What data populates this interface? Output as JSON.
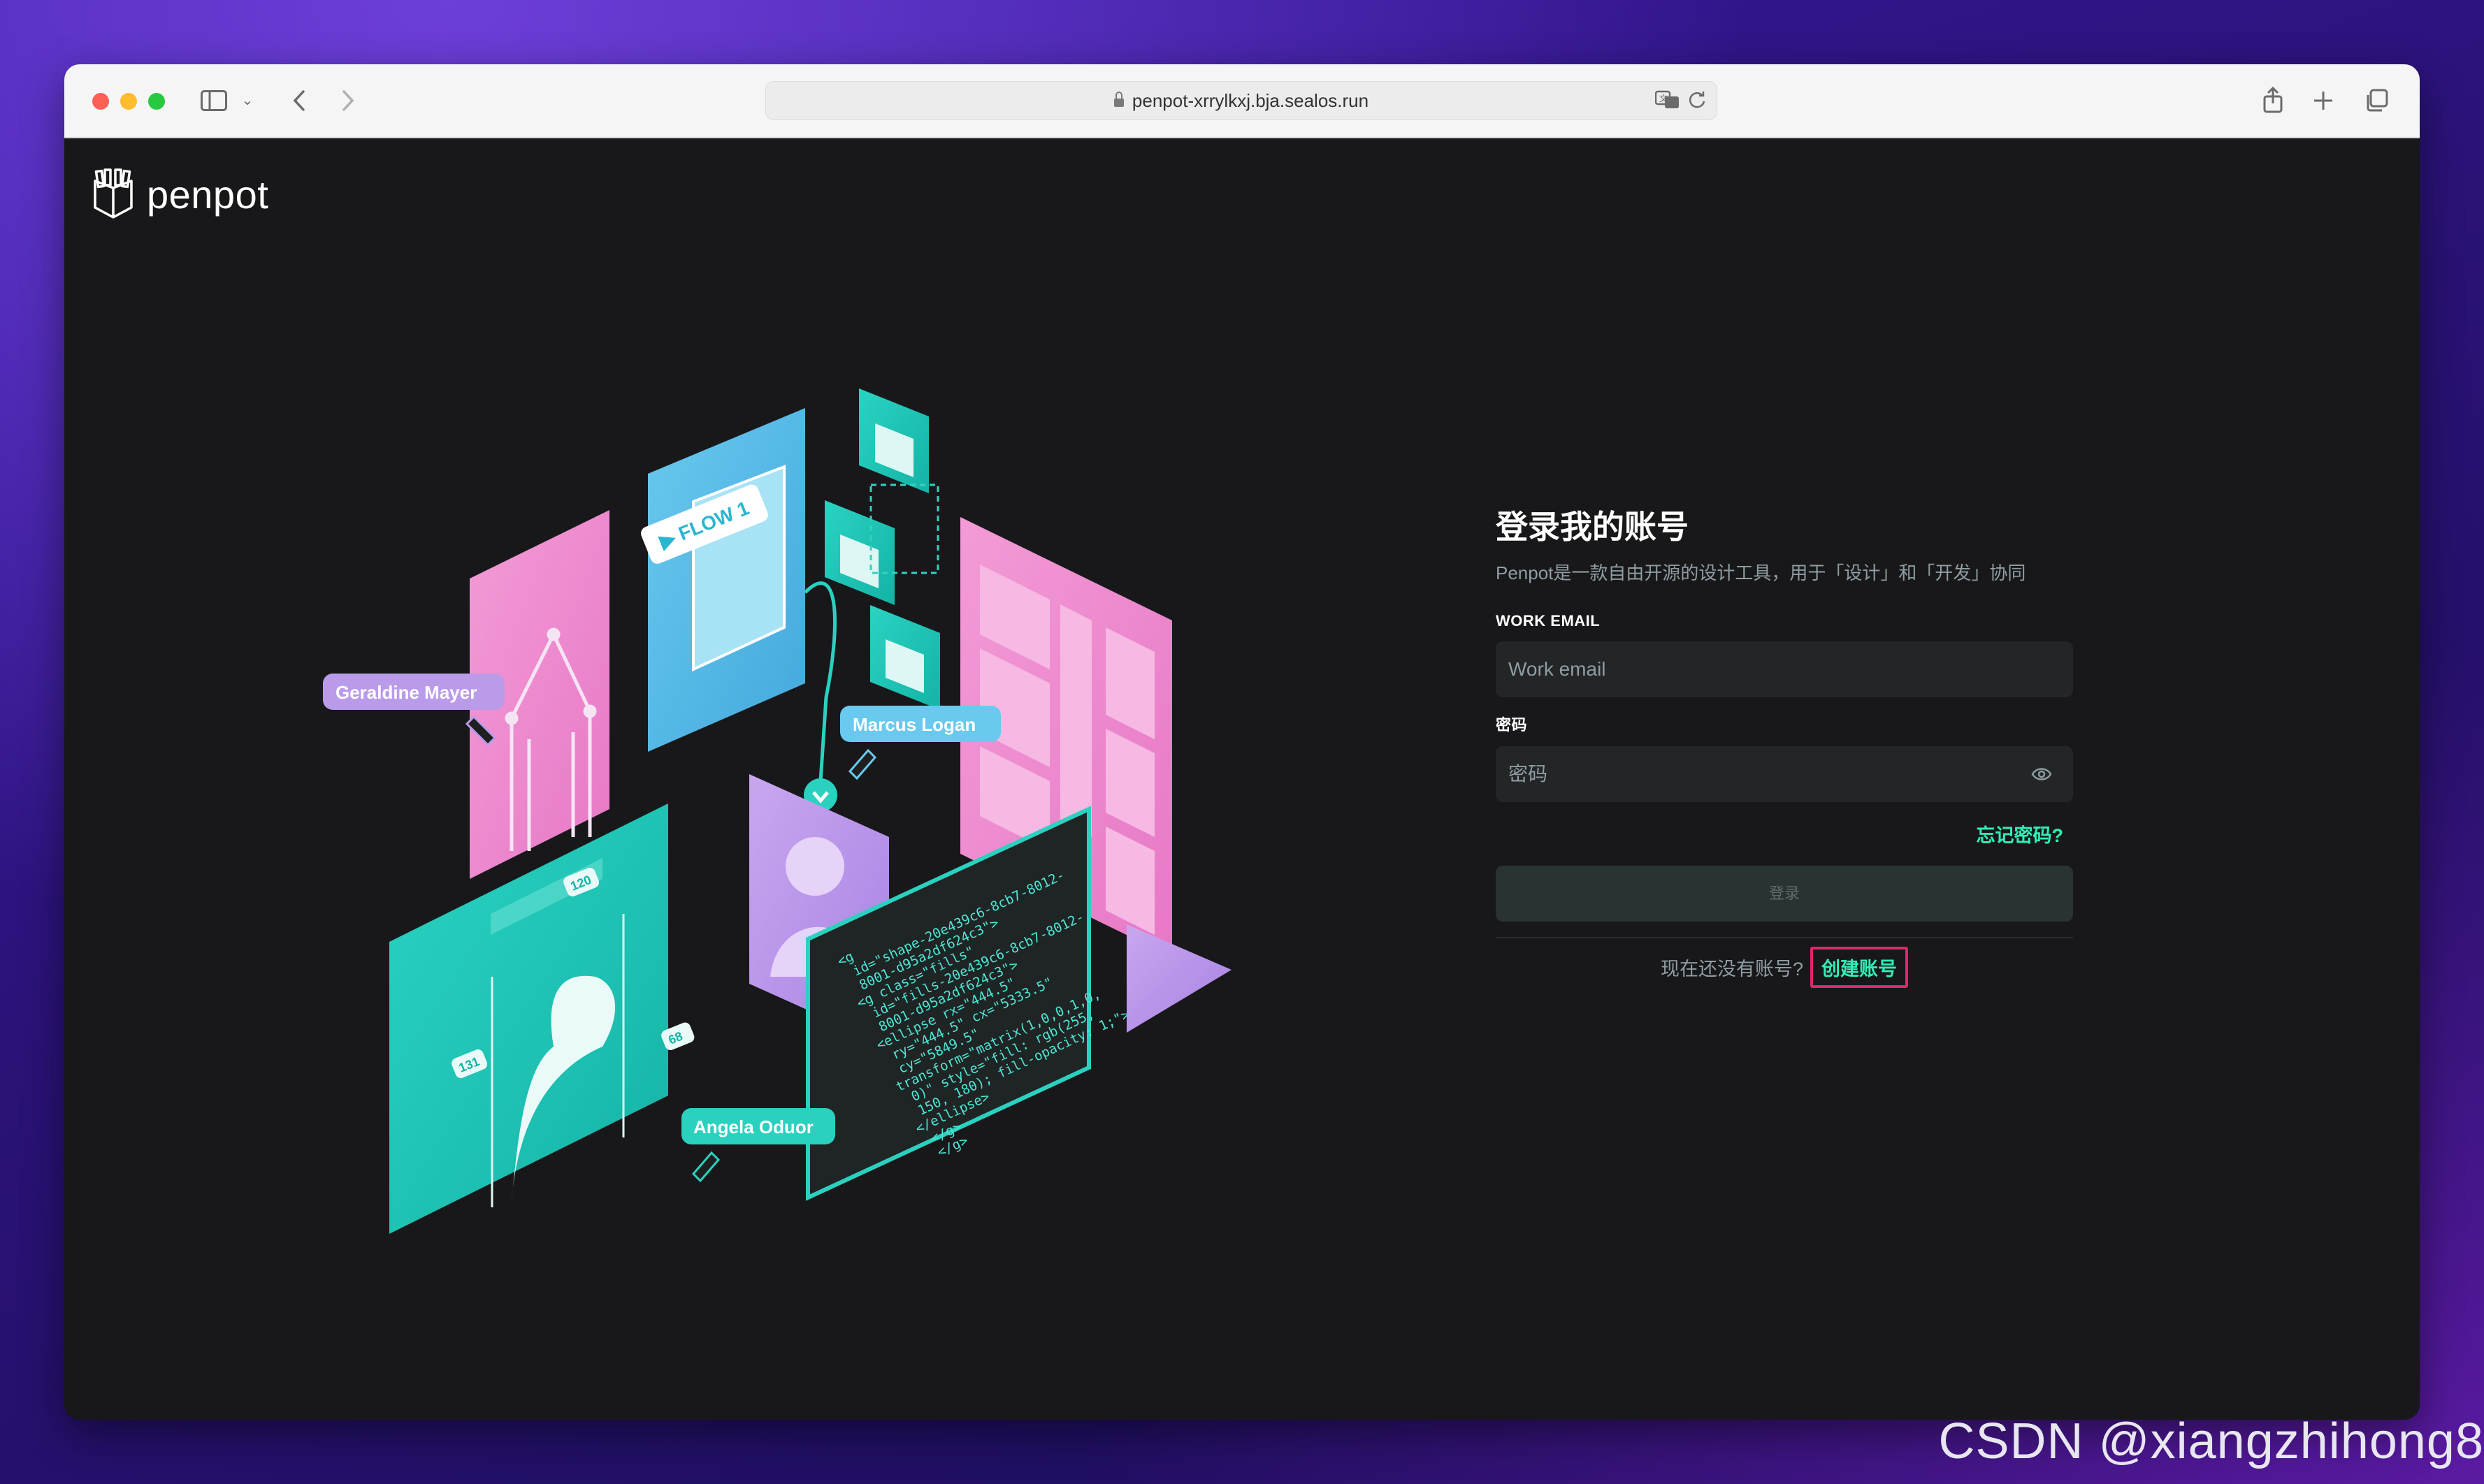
{
  "browser": {
    "url": "penpot-xrrylkxj.bja.sealos.run"
  },
  "app": {
    "logo_text": "penpot"
  },
  "login": {
    "title": "登录我的账号",
    "subtitle": "Penpot是一款自由开源的设计工具，用于「设计」和「开发」协同",
    "email_label": "WORK EMAIL",
    "email_placeholder": "Work email",
    "password_label": "密码",
    "password_placeholder": "密码",
    "forgot_link": "忘记密码?",
    "login_button": "登录",
    "no_account_text": "现在还没有账号?",
    "create_account_link": "创建账号"
  },
  "illustration": {
    "flow_tag": "▶ FLOW 1",
    "user_1": "Geraldine Mayer",
    "user_2": "Marcus Logan",
    "user_3": "Angela Oduor",
    "code_lines": [
      "<g",
      "id=\"shape-20e439c6-8cb7-8012-",
      "8001-d95a2df624c3\">",
      "<g class=\"fills\"",
      "id=\"fills-20e439c6-8cb7-8012-",
      "8001-d95a2df624c3\">",
      "<ellipse rx=\"444.5\"",
      "ry=\"444.5\" cx=\"5333.5\"",
      "cy=\"5849.5\"",
      "transform=\"matrix(1,0,0,1,0,",
      "0)\" style=\"fill: rgb(255,",
      "150, 180); fill-opacity: 1;\">",
      "</ellipse>",
      "</g>",
      "</g>"
    ],
    "badges": [
      "120",
      "131",
      "68"
    ]
  },
  "watermark": "CSDN @xiangzhihong8",
  "colors": {
    "accent": "#31efb8",
    "background": "#18181a",
    "field_bg": "#232527",
    "highlight_border": "#e0266d"
  }
}
